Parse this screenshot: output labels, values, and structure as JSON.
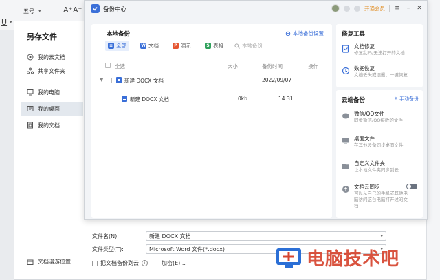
{
  "toolbar": {
    "font_size": "五号",
    "grow": "A⁺",
    "shrink": "A⁻",
    "underline": "U"
  },
  "saveas": {
    "title": "另存文件",
    "sidebar": [
      {
        "label": "我的云文档",
        "icon": "cloud-doc-icon"
      },
      {
        "label": "共享文件夹",
        "icon": "share-folder-icon"
      },
      {
        "label": "我的电脑",
        "icon": "computer-icon"
      },
      {
        "label": "我的桌面",
        "icon": "desktop-icon",
        "active": true
      },
      {
        "label": "我的文档",
        "icon": "documents-icon"
      }
    ],
    "bottom_item": "文档漫游位置",
    "filename_label": "文件名(N):",
    "filename_value": "新建 DOCX 文档",
    "filetype_label": "文件类型(T):",
    "filetype_value": "Microsoft Word 文件(*.docx)",
    "backup_checkbox": "把文档备份到云",
    "encrypt": "加密(E)..."
  },
  "backup_center": {
    "title": "备份中心",
    "vip": "开通会员",
    "local": {
      "title": "本地备份",
      "settings": "本地备份设置",
      "tabs": [
        {
          "label": "全部",
          "badge": "≡",
          "color": "#3a6fd8",
          "active": true
        },
        {
          "label": "文档",
          "badge": "W",
          "color": "#3a6fd8"
        },
        {
          "label": "演示",
          "badge": "P",
          "color": "#e5542f"
        },
        {
          "label": "表格",
          "badge": "S",
          "color": "#2ea05a"
        }
      ],
      "search_placeholder": "本地备份",
      "columns": {
        "select_all": "全选",
        "size": "大小",
        "time": "备份时间",
        "action": "操作"
      },
      "group": {
        "name": "新建 DOCX 文档",
        "date": "2022/09/07"
      },
      "item": {
        "name": "新建 DOCX 文档",
        "size": "0kb",
        "time": "14:31"
      }
    },
    "repair": {
      "title": "修复工具",
      "items": [
        {
          "title": "文档修复",
          "desc": "修复乱码/无法打开的文档"
        },
        {
          "title": "数据恢复",
          "desc": "文档丢失或误删，一键恢复"
        }
      ]
    },
    "cloud": {
      "title": "云端备份",
      "manual": "手动备份",
      "items": [
        {
          "title": "微信/QQ文件",
          "desc": "同步微信/QQ接收的文件"
        },
        {
          "title": "桌面文件",
          "desc": "在其他设备同步桌面文件"
        },
        {
          "title": "自定义文件夹",
          "desc": "让本地文件夹同步到云"
        },
        {
          "title": "文档云同步",
          "desc": "可以从自己的手机或其他电脑访问这台电脑打开过的文档",
          "toggle": "on"
        }
      ]
    }
  },
  "watermark": "电脑技术吧"
}
